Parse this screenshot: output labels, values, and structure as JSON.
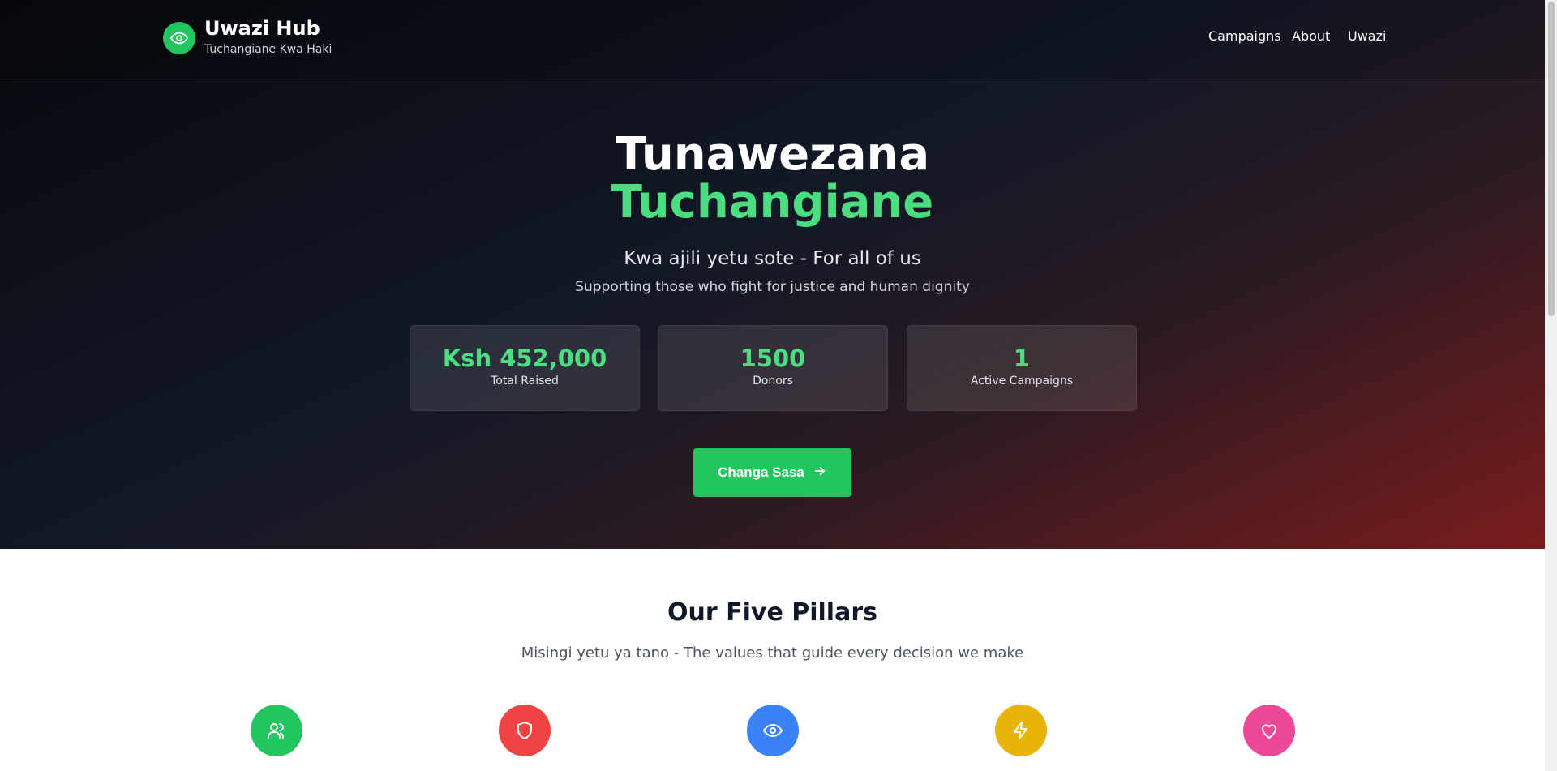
{
  "brand": {
    "name": "Uwazi Hub",
    "tagline": "Tuchangiane Kwa Haki",
    "icon": "eye-icon"
  },
  "nav": {
    "links": [
      "Campaigns",
      "About",
      "Uwazi"
    ]
  },
  "hero": {
    "title_line1": "Tunawezana",
    "title_line2": "Tuchangiane",
    "subtitle": "Kwa ajili yetu sote - For all of us",
    "description": "Supporting those who fight for justice and human dignity",
    "stats": [
      {
        "value": "Ksh 452,000",
        "label": "Total Raised"
      },
      {
        "value": "1500",
        "label": "Donors"
      },
      {
        "value": "1",
        "label": "Active Campaigns"
      }
    ],
    "cta_label": "Changa Sasa",
    "cta_icon": "arrow-right-icon"
  },
  "pillars": {
    "title": "Our Five Pillars",
    "subtitle": "Misingi yetu ya tano - The values that guide every decision we make",
    "items": [
      {
        "icon": "users-icon",
        "color": "#22c55e"
      },
      {
        "icon": "shield-icon",
        "color": "#ef4444"
      },
      {
        "icon": "eye-icon",
        "color": "#3b82f6"
      },
      {
        "icon": "lightning-icon",
        "color": "#eab308"
      },
      {
        "icon": "heart-icon",
        "color": "#ec4899"
      }
    ]
  },
  "colors": {
    "accent": "#22c55e",
    "accent_light": "#4ade80",
    "hero_red": "#7a1c1c"
  }
}
